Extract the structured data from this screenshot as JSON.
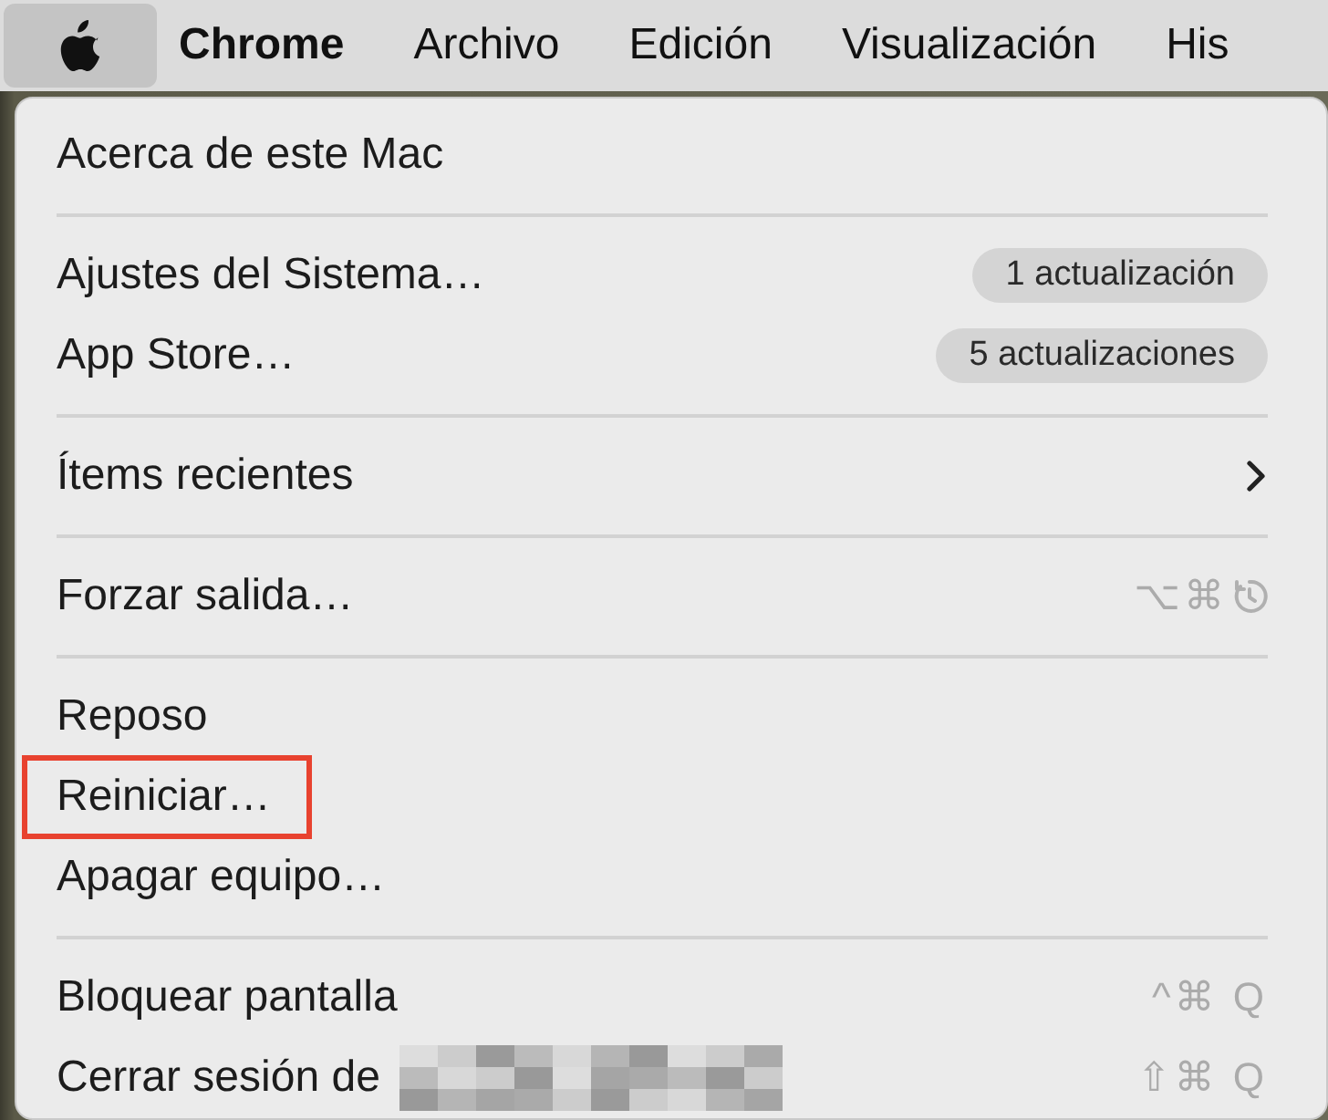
{
  "menu_bar": {
    "items": [
      {
        "kind": "apple",
        "selected": true
      },
      {
        "label": "Chrome",
        "kind": "app",
        "selected": false
      },
      {
        "label": "Archivo",
        "kind": "menu",
        "selected": false
      },
      {
        "label": "Edición",
        "kind": "menu",
        "selected": false
      },
      {
        "label": "Visualización",
        "kind": "menu",
        "selected": false
      },
      {
        "label": "His",
        "kind": "menu",
        "selected": false
      }
    ]
  },
  "menu": {
    "items": [
      {
        "kind": "item",
        "label": "Acerca de este Mac"
      },
      {
        "kind": "separator"
      },
      {
        "kind": "item",
        "label": "Ajustes del Sistema…",
        "badge": "1 actualización"
      },
      {
        "kind": "item",
        "label": "App Store…",
        "badge": "5 actualizaciones"
      },
      {
        "kind": "separator"
      },
      {
        "kind": "submenu",
        "label": "Ítems recientes"
      },
      {
        "kind": "separator"
      },
      {
        "kind": "item",
        "label": "Forzar salida…",
        "shortcut": "⌥⌘",
        "restart_icon": true
      },
      {
        "kind": "separator"
      },
      {
        "kind": "item",
        "label": "Reposo"
      },
      {
        "kind": "item",
        "label": "Reiniciar…",
        "highlighted": true
      },
      {
        "kind": "item",
        "label": "Apagar equipo…"
      },
      {
        "kind": "separator"
      },
      {
        "kind": "item",
        "label": "Bloquear pantalla",
        "shortcut": "^⌘ Q"
      },
      {
        "kind": "item",
        "label": "Cerrar sesión de",
        "redacted": true,
        "shortcut": "⇧⌘ Q"
      }
    ]
  }
}
